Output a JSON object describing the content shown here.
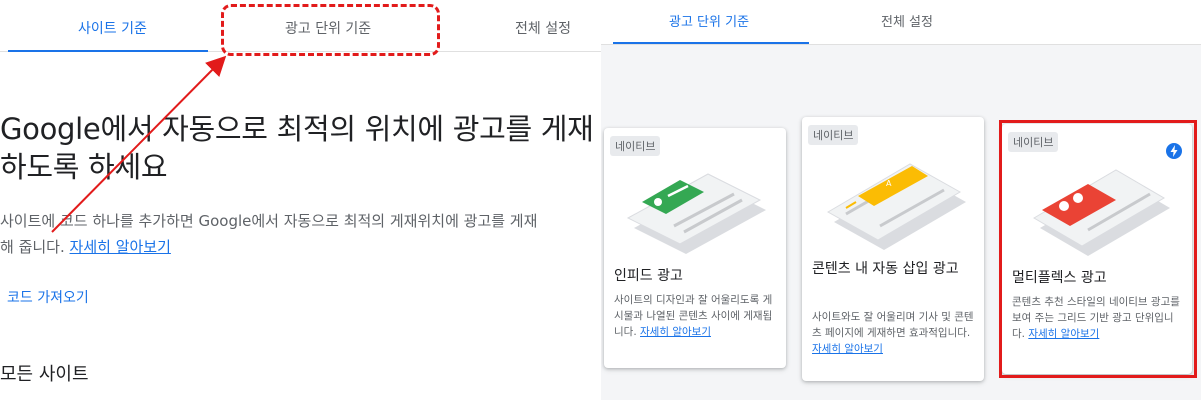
{
  "left": {
    "tabs": [
      "사이트 기준",
      "광고 단위 기준",
      "전체 설정"
    ],
    "headline_line1": "Google에서 자동으로 최적의 위치에 광고를 게재",
    "headline_line2": "하도록 하세요",
    "desc_line1": "사이트에 코드 하나를 추가하면 Google에서 자동으로 최적의 게재위치에 광고를 게재",
    "desc_line2": "해 줍니다.",
    "learn_more": "자세히 알아보기",
    "get_code": "코드 가져오기",
    "all_sites": "모든 사이트"
  },
  "right": {
    "tabs": [
      "광고 단위 기준",
      "전체 설정"
    ],
    "cards": [
      {
        "badge": "네이티브",
        "title": "인피드 광고",
        "desc": "사이트의 디자인과 잘 어울리도록 게시물과 나열된 콘텐츠 사이에 게재됩니다.",
        "learn_more": "자세히 알아보기"
      },
      {
        "badge": "네이티브",
        "title": "콘텐츠 내 자동 삽입 광고",
        "desc": "사이트와도 잘 어울리며 기사 및 콘텐츠 페이지에 게재하면 효과적입니다.",
        "learn_more": "자세히 알아보기"
      },
      {
        "badge": "네이티브",
        "title": "멀티플렉스 광고",
        "desc": "콘텐츠 추천 스타일의 네이티브 광고를 보여 주는 그리드 기반 광고 단위입니다.",
        "learn_more": "자세히 알아보기"
      }
    ]
  },
  "colors": {
    "accent": "#1a73e8",
    "annotation_red": "#e21b1b",
    "infeed_green": "#34a853",
    "inarticle_yellow": "#fbbc04",
    "multiplex_red": "#ea4335"
  },
  "icons": [
    "bolt-icon"
  ]
}
